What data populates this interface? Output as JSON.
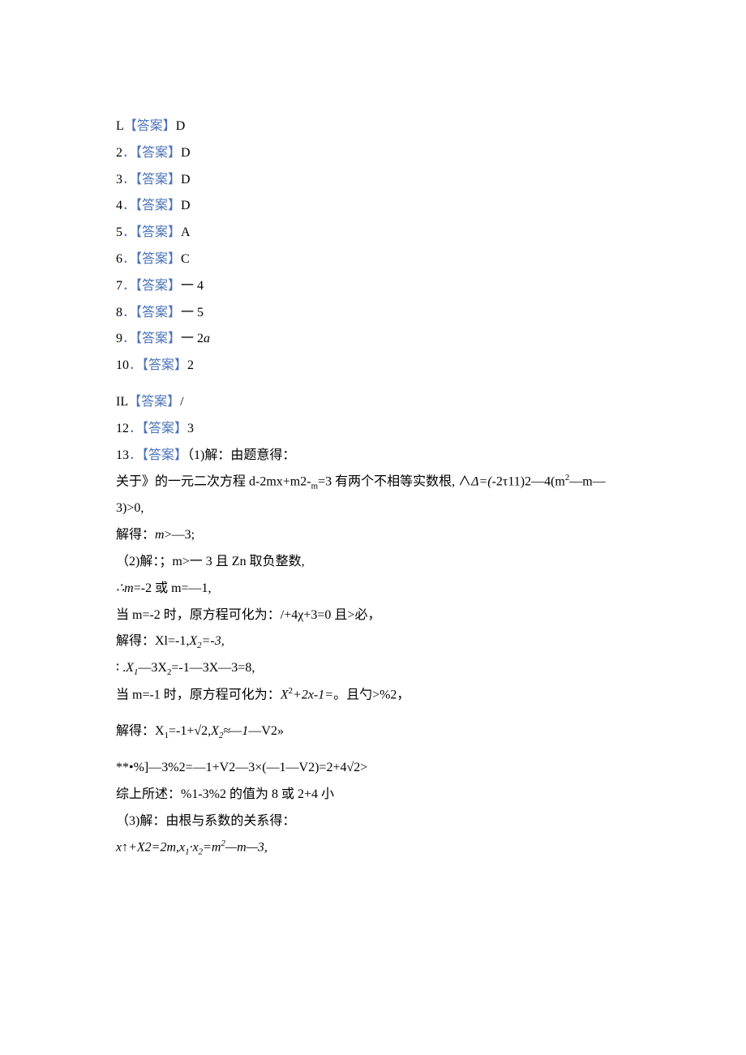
{
  "answers": [
    {
      "n": "L",
      "label": "【答案】",
      "val": "D"
    },
    {
      "n": "2",
      "label": "．【答案】",
      "val": "D"
    },
    {
      "n": "3",
      "label": "．【答案】",
      "val": "D"
    },
    {
      "n": "4",
      "label": "．【答案】",
      "val": "D"
    },
    {
      "n": "5",
      "label": "．【答案】",
      "val": "A"
    },
    {
      "n": "6",
      "label": "．【答案】",
      "val": "C"
    },
    {
      "n": "7",
      "label": "．【答案】",
      "val": "一 4"
    },
    {
      "n": "8",
      "label": "．【答案】",
      "val": "一 5"
    },
    {
      "n": "9",
      "label": "．【答案】",
      "val_prefix": "一 2",
      "val_it": "a"
    },
    {
      "n": "10",
      "label": "．【答案】",
      "val": "2"
    },
    {
      "n": "IL",
      "label": "【答案】",
      "val": "/"
    },
    {
      "n": "12",
      "label": "．【答案】",
      "val": "3"
    }
  ],
  "q13": {
    "head_n": "13",
    "head_label": "．【答案】",
    "head_rest": "（1)解：由题意得：",
    "p2a": "关于》的一元二次方程 d-2mx+m2-",
    "p2b": "m",
    "p2c": "=3 有两个不相等实数根, ∧",
    "p2d": "Δ=(",
    "p2e": "-2τ11)2—4(m",
    "p2f": "2",
    "p2g": "—m—",
    "p3": "3)>0,",
    "p4a": "解得：",
    "p4b": "m",
    "p4c": ">—3;",
    "p5": "（2)解：；m>一 3 且 Zn 取负整数,",
    "p6a": "∴m",
    "p6b": "=-2 或 m=—1,",
    "p7": "当 m=-2 时，原方程可化为：/+4χ+3=0 且>必，",
    "p8a": "解得：Xl=-1,",
    "p8b": "X",
    "p8c": "2",
    "p8d": "=-3,",
    "p9a": "∶ .",
    "p9b": "X",
    "p9c": "1",
    "p9d": "—3",
    "p9e": "X",
    "p9f": "2",
    "p9g": "=-1—3X—3=8,",
    "p10a": "当 m=-1 时，原方程可化为：",
    "p10b": "X",
    "p10c": "2",
    "p10d": "+2x-1=",
    "p10e": "。且勺>%2，",
    "p11a": "解得：X",
    "p11b": "1",
    "p11c": "=-1+√2,",
    "p11d": "X",
    "p11e": "2",
    "p11f": "≈—1",
    "p11g": "—V2»",
    "p12": "**•%]—3%2=—1+V2—3×(—1—V2)=2+4√2>",
    "p13": "综上所述：%1-3%2 的值为 8 或 2+4 小",
    "p14": "（3)解：由根与系数的关系得：",
    "p15a": "x↑+X2=2m,x",
    "p15b": "1",
    "p15c": "·x",
    "p15d": "2",
    "p15e": "=m",
    "p15f": "2",
    "p15g": "—m—3,"
  }
}
